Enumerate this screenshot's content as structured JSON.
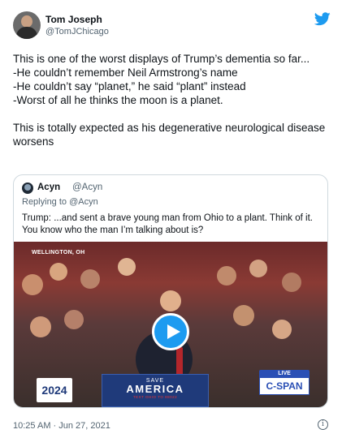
{
  "author": {
    "name": "Tom Joseph",
    "handle": "@TomJChicago",
    "avatar_icon": "person-avatar-icon"
  },
  "brand": {
    "icon": "twitter-bird-icon",
    "color": "#1d9bf0"
  },
  "tweet": {
    "lines": [
      "This is one of the worst displays of Trump’s dementia so far...",
      "-He couldn’t remember Neil Armstrong’s name",
      "-He couldn’t say “planet,” he said “plant” instead",
      "-Worst of all he thinks the moon is a planet."
    ],
    "closing": "This is totally expected as his degenerative neurological disease worsens"
  },
  "quoted": {
    "name": "Acyn",
    "handle": "@Acyn",
    "reply_prefix": "Replying to",
    "reply_to": "@Acyn",
    "text": "Trump: ...and sent a brave young man from Ohio to a plant. Think of it. You know who the man I’m talking about is?",
    "video": {
      "location": "WELLINGTON, OH",
      "podium_top": "SAVE",
      "podium_main": "AMERICA",
      "podium_sub": "TEXT OHIO TO 88022",
      "year_sign": "2024",
      "network_live": "LIVE",
      "network": "C-SPAN",
      "play_icon": "play-icon"
    }
  },
  "meta": {
    "timestamp": "10:25 AM · Jun 27, 2021",
    "info_icon": "info-icon"
  }
}
